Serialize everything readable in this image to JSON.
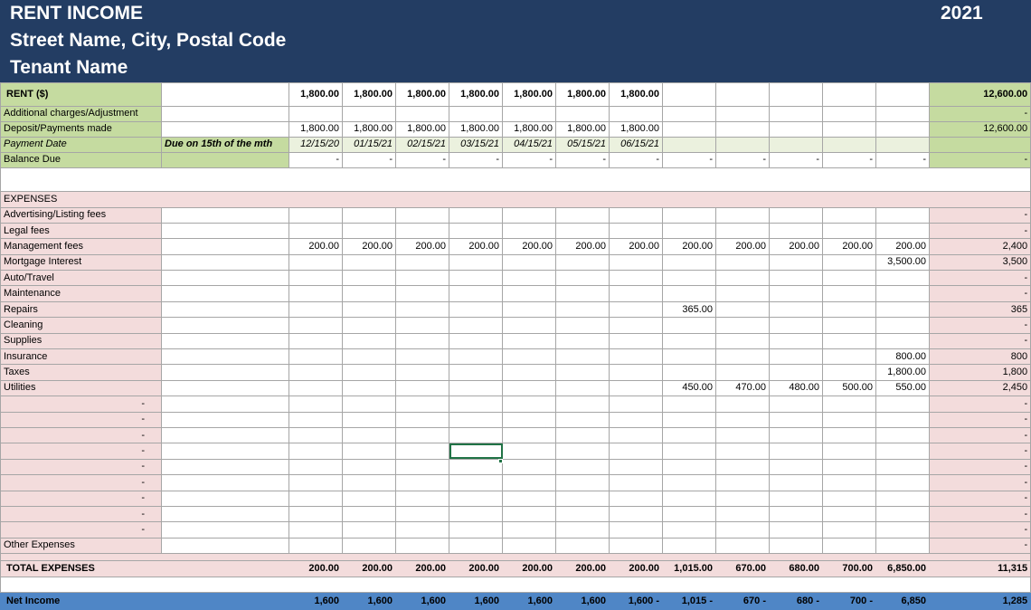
{
  "header": {
    "title": "RENT INCOME",
    "address": "Street Name, City, Postal Code",
    "tenant": "Tenant Name",
    "year": "2021"
  },
  "income": {
    "rent": {
      "label": "RENT ($)",
      "months": [
        "1,800.00",
        "1,800.00",
        "1,800.00",
        "1,800.00",
        "1,800.00",
        "1,800.00",
        "1,800.00",
        "",
        "",
        "",
        "",
        ""
      ],
      "total": "12,600.00"
    },
    "additional": {
      "label": "Additional charges/Adjustment",
      "months": [
        "",
        "",
        "",
        "",
        "",
        "",
        "",
        "",
        "",
        "",
        "",
        ""
      ],
      "total": "-"
    },
    "deposit": {
      "label": "Deposit/Payments made",
      "months": [
        "1,800.00",
        "1,800.00",
        "1,800.00",
        "1,800.00",
        "1,800.00",
        "1,800.00",
        "1,800.00",
        "",
        "",
        "",
        "",
        ""
      ],
      "total": "12,600.00"
    },
    "payment_date": {
      "label": "Payment Date",
      "note": "Due on 15th of the mth",
      "months": [
        "12/15/20",
        "01/15/21",
        "02/15/21",
        "03/15/21",
        "04/15/21",
        "05/15/21",
        "06/15/21",
        "",
        "",
        "",
        "",
        ""
      ],
      "total": ""
    },
    "balance": {
      "label": "Balance Due",
      "months": [
        "-",
        "-",
        "-",
        "-",
        "-",
        "-",
        "-",
        "-",
        "-",
        "-",
        "-",
        "-"
      ],
      "total": "-"
    }
  },
  "expenses": {
    "header": "EXPENSES",
    "rows": [
      {
        "label": "Advertising/Listing fees",
        "months": [
          "",
          "",
          "",
          "",
          "",
          "",
          "",
          "",
          "",
          "",
          "",
          ""
        ],
        "total": "-"
      },
      {
        "label": "Legal fees",
        "months": [
          "",
          "",
          "",
          "",
          "",
          "",
          "",
          "",
          "",
          "",
          "",
          ""
        ],
        "total": "-"
      },
      {
        "label": "Management fees",
        "months": [
          "200.00",
          "200.00",
          "200.00",
          "200.00",
          "200.00",
          "200.00",
          "200.00",
          "200.00",
          "200.00",
          "200.00",
          "200.00",
          "200.00"
        ],
        "total": "2,400"
      },
      {
        "label": "Mortgage Interest",
        "months": [
          "",
          "",
          "",
          "",
          "",
          "",
          "",
          "",
          "",
          "",
          "",
          "3,500.00"
        ],
        "total": "3,500"
      },
      {
        "label": "Auto/Travel",
        "months": [
          "",
          "",
          "",
          "",
          "",
          "",
          "",
          "",
          "",
          "",
          "",
          ""
        ],
        "total": "-"
      },
      {
        "label": "Maintenance",
        "months": [
          "",
          "",
          "",
          "",
          "",
          "",
          "",
          "",
          "",
          "",
          "",
          ""
        ],
        "total": "-"
      },
      {
        "label": "Repairs",
        "months": [
          "",
          "",
          "",
          "",
          "",
          "",
          "",
          "365.00",
          "",
          "",
          "",
          ""
        ],
        "total": "365"
      },
      {
        "label": "Cleaning",
        "months": [
          "",
          "",
          "",
          "",
          "",
          "",
          "",
          "",
          "",
          "",
          "",
          ""
        ],
        "total": "-"
      },
      {
        "label": "Supplies",
        "months": [
          "",
          "",
          "",
          "",
          "",
          "",
          "",
          "",
          "",
          "",
          "",
          ""
        ],
        "total": "-"
      },
      {
        "label": "Insurance",
        "months": [
          "",
          "",
          "",
          "",
          "",
          "",
          "",
          "",
          "",
          "",
          "",
          "800.00"
        ],
        "total": "800"
      },
      {
        "label": "Taxes",
        "months": [
          "",
          "",
          "",
          "",
          "",
          "",
          "",
          "",
          "",
          "",
          "",
          "1,800.00"
        ],
        "total": "1,800"
      },
      {
        "label": "Utilities",
        "months": [
          "",
          "",
          "",
          "",
          "",
          "",
          "",
          "450.00",
          "470.00",
          "480.00",
          "500.00",
          "550.00"
        ],
        "total": "2,450"
      },
      {
        "label": "-",
        "months": [
          "",
          "",
          "",
          "",
          "",
          "",
          "",
          "",
          "",
          "",
          "",
          ""
        ],
        "total": "-"
      },
      {
        "label": "-",
        "months": [
          "",
          "",
          "",
          "",
          "",
          "",
          "",
          "",
          "",
          "",
          "",
          ""
        ],
        "total": "-"
      },
      {
        "label": "-",
        "months": [
          "",
          "",
          "",
          "",
          "",
          "",
          "",
          "",
          "",
          "",
          "",
          ""
        ],
        "total": "-"
      },
      {
        "label": "-",
        "months": [
          "",
          "",
          "",
          "",
          "",
          "",
          "",
          "",
          "",
          "",
          "",
          ""
        ],
        "total": "-"
      },
      {
        "label": "-",
        "months": [
          "",
          "",
          "",
          "",
          "",
          "",
          "",
          "",
          "",
          "",
          "",
          ""
        ],
        "total": "-"
      },
      {
        "label": "-",
        "months": [
          "",
          "",
          "",
          "",
          "",
          "",
          "",
          "",
          "",
          "",
          "",
          ""
        ],
        "total": "-"
      },
      {
        "label": "-",
        "months": [
          "",
          "",
          "",
          "",
          "",
          "",
          "",
          "",
          "",
          "",
          "",
          ""
        ],
        "total": "-"
      },
      {
        "label": "-",
        "months": [
          "",
          "",
          "",
          "",
          "",
          "",
          "",
          "",
          "",
          "",
          "",
          ""
        ],
        "total": "-"
      },
      {
        "label": "-",
        "months": [
          "",
          "",
          "",
          "",
          "",
          "",
          "",
          "",
          "",
          "",
          "",
          ""
        ],
        "total": "-"
      },
      {
        "label": "Other Expenses",
        "months": [
          "",
          "",
          "",
          "",
          "",
          "",
          "",
          "",
          "",
          "",
          "",
          ""
        ],
        "total": "-"
      }
    ]
  },
  "total_expenses": {
    "label": "TOTAL EXPENSES",
    "months": [
      "200.00",
      "200.00",
      "200.00",
      "200.00",
      "200.00",
      "200.00",
      "200.00",
      "1,015.00",
      "670.00",
      "680.00",
      "700.00",
      "6,850.00"
    ],
    "total": "11,315"
  },
  "net_income": {
    "label": "Net Income",
    "months": [
      "1,600",
      "1,600",
      "1,600",
      "1,600",
      "1,600",
      "1,600",
      "1,600 -",
      "1,015 -",
      "670 -",
      "680 -",
      "700 -",
      "6,850"
    ],
    "total": "1,285"
  },
  "colors": {
    "banner": "#233d63",
    "income_green": "#c5dba0",
    "expense_pink": "#f3dcdc",
    "net_blue": "#4f86c6",
    "selection_green": "#217346"
  }
}
